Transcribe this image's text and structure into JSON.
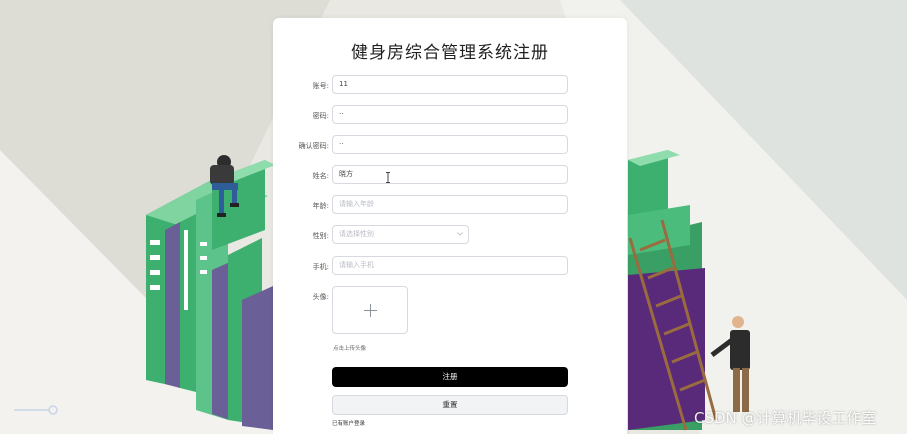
{
  "form": {
    "title": "健身房综合管理系统注册",
    "fields": [
      {
        "label": "账号:",
        "value": "11",
        "placeholder": ""
      },
      {
        "label": "密码:",
        "value": "··",
        "placeholder": ""
      },
      {
        "label": "确认密码:",
        "value": "··",
        "placeholder": ""
      },
      {
        "label": "姓名:",
        "value": "晓方",
        "placeholder": ""
      },
      {
        "label": "年龄:",
        "value": "",
        "placeholder": "请输入年龄"
      },
      {
        "label": "性别:",
        "value": "",
        "placeholder": "请选择性别"
      },
      {
        "label": "手机:",
        "value": "",
        "placeholder": "请输入手机"
      }
    ],
    "avatar_label": "头像:",
    "avatar_hint": "点击上传头像",
    "submit_label": "注册",
    "reset_label": "重置",
    "login_link": "已有账户登录"
  },
  "watermark": "CSDN @计算机毕设工作室",
  "colors": {
    "background": "#e9e8e3",
    "book_green": "#3db070",
    "book_purple": "#6a5f96",
    "button_primary": "#000000"
  }
}
